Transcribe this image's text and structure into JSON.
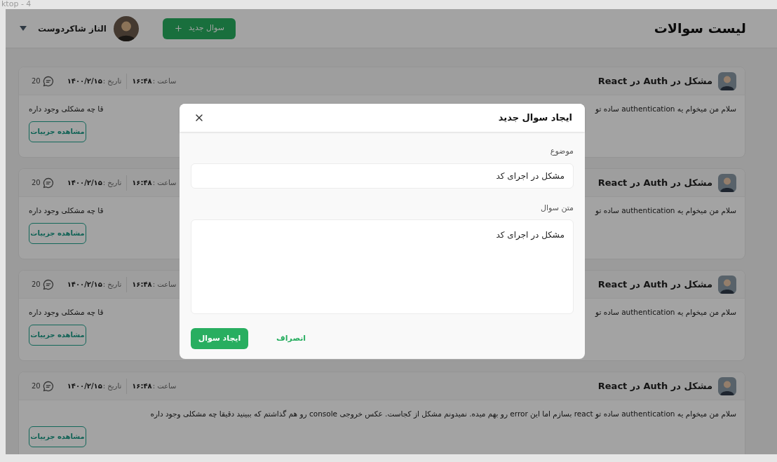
{
  "canvas": {
    "frame_label": "ktop - 4"
  },
  "header": {
    "title": "لیست سوالات",
    "new_button": "سوال جدید",
    "user_name": "الناز شاکردوست"
  },
  "questions": [
    {
      "title": "مشکل در Auth در React",
      "time_label": "ساعت :",
      "time": "۱۶:۴۸",
      "date_label": "تاریخ :",
      "date": "۱۴۰۰/۲/۱۵",
      "comments": "20",
      "body_parts": [
        "سلام من میخوام یه authentication ساده تو",
        "قا چه مشکلی وجود داره"
      ],
      "details_button": "مشاهده جزییات"
    },
    {
      "title": "مشکل در Auth در React",
      "time_label": "ساعت :",
      "time": "۱۶:۴۸",
      "date_label": "تاریخ :",
      "date": "۱۴۰۰/۲/۱۵",
      "comments": "20",
      "body_parts": [
        "سلام من میخوام یه authentication ساده تو",
        "قا چه مشکلی وجود داره"
      ],
      "details_button": "مشاهده جزییات"
    },
    {
      "title": "مشکل در Auth در React",
      "time_label": "ساعت :",
      "time": "۱۶:۴۸",
      "date_label": "تاریخ :",
      "date": "۱۴۰۰/۲/۱۵",
      "comments": "20",
      "body_parts": [
        "سلام من میخوام یه authentication ساده تو",
        "قا چه مشکلی وجود داره"
      ],
      "details_button": "مشاهده جزییات"
    },
    {
      "title": "مشکل در Auth در React",
      "time_label": "ساعت :",
      "time": "۱۶:۴۸",
      "date_label": "تاریخ :",
      "date": "۱۴۰۰/۲/۱۵",
      "comments": "20",
      "body_parts": [
        "سلام من میخوام یه authentication ساده تو react بسازم اما این error رو بهم میده. نمیدونم مشکل از کجاست. عکس خروجی console رو هم گذاشتم که ببینید دقیقا چه مشکلی وجود داره"
      ],
      "details_button": "مشاهده جزییات"
    }
  ],
  "modal": {
    "title": "ایجاد سوال جدید",
    "fields": [
      {
        "kind": "input",
        "label": "موضوع",
        "value": "مشکل در اجرای کد"
      },
      {
        "kind": "textarea",
        "label": "متن سوال",
        "value": "مشکل در اجرای کد"
      }
    ],
    "submit": "ایجاد سوال",
    "cancel": "انصراف"
  }
}
